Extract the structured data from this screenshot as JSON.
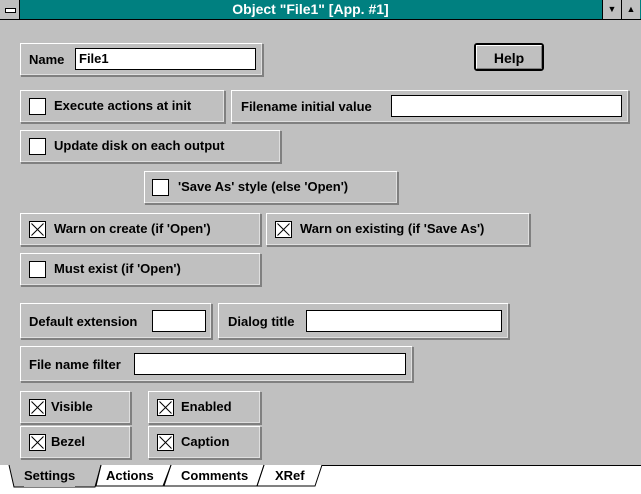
{
  "window": {
    "title": "Object \"File1\" [App. #1]",
    "system_icon": "system-menu-icon",
    "minimize_icon": "minimize-icon",
    "maximize_icon": "maximize-icon"
  },
  "settings": {
    "name_label": "Name",
    "name_value": "File1",
    "help_label": "Help",
    "execute_actions_label": "Execute actions at init",
    "execute_actions_checked": false,
    "filename_initial_label": "Filename initial value",
    "filename_initial_value": "",
    "update_disk_label": "Update disk on each output",
    "update_disk_checked": false,
    "save_as_style_label": "'Save As' style (else 'Open')",
    "save_as_style_checked": false,
    "warn_on_create_label": "Warn on create (if 'Open')",
    "warn_on_create_checked": true,
    "warn_on_existing_label": "Warn on existing (if 'Save As')",
    "warn_on_existing_checked": true,
    "must_exist_label": "Must exist (if 'Open')",
    "must_exist_checked": false,
    "default_extension_label": "Default extension",
    "default_extension_value": "",
    "dialog_title_label": "Dialog title",
    "dialog_title_value": "",
    "file_name_filter_label": "File name filter",
    "file_name_filter_value": "",
    "visible_label": "Visible",
    "visible_checked": true,
    "enabled_label": "Enabled",
    "enabled_checked": true,
    "bezel_label": "Bezel",
    "bezel_checked": true,
    "caption_label": "Caption",
    "caption_checked": true
  },
  "tabs": [
    {
      "label": "Settings",
      "active": true
    },
    {
      "label": "Actions",
      "active": false
    },
    {
      "label": "Comments",
      "active": false
    },
    {
      "label": "XRef",
      "active": false
    }
  ]
}
